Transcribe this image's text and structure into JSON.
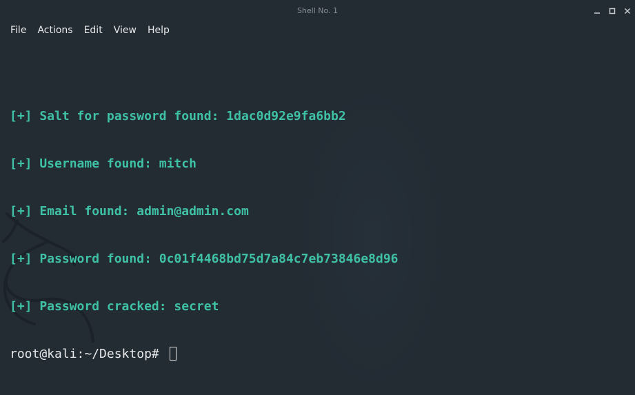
{
  "window": {
    "title": "Shell No. 1",
    "colors": {
      "background": "#232b33",
      "output_text": "#3fc1a5",
      "prompt_text": "#e6e8ea"
    }
  },
  "menu": {
    "items": [
      "File",
      "Actions",
      "Edit",
      "View",
      "Help"
    ]
  },
  "terminal": {
    "lines": [
      "[+] Salt for password found: 1dac0d92e9fa6bb2",
      "[+] Username found: mitch",
      "[+] Email found: admin@admin.com",
      "[+] Password found: 0c01f4468bd75d7a84c7eb73846e8d96",
      "[+] Password cracked: secret"
    ],
    "prompt": "root@kali:~/Desktop# "
  }
}
